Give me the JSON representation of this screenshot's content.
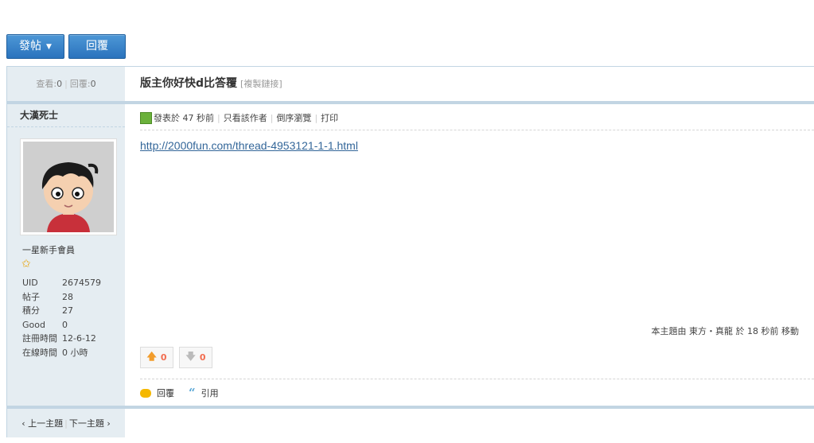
{
  "toolbar": {
    "post_label": "發帖",
    "reply_label": "回覆",
    "caret": "▼"
  },
  "stats": {
    "views_label": "查看:",
    "views": "0",
    "replies_label": "回覆:",
    "replies": "0"
  },
  "thread": {
    "title": "版主你好快d比答覆",
    "copy_link": "[複製鏈接]"
  },
  "author": {
    "name": "大漢死士",
    "rank": "一星新手會員",
    "info": [
      {
        "k": "UID",
        "v": "2674579"
      },
      {
        "k": "帖子",
        "v": "28"
      },
      {
        "k": "積分",
        "v": "27"
      },
      {
        "k": "Good",
        "v": "0"
      },
      {
        "k": "註冊時間",
        "v": "12-6-12"
      },
      {
        "k": "在線時間",
        "v": "0 小時"
      }
    ]
  },
  "meta": {
    "posted": "發表於 47 秒前",
    "only_author": "只看該作者",
    "reverse": "倒序瀏覽",
    "print": "打印"
  },
  "post": {
    "link": "http://2000fun.com/thread-4953121-1-1.html"
  },
  "moved_note": "本主題由 東方・真龍 於 18 秒前 移動",
  "votes": {
    "up": "0",
    "down": "0"
  },
  "actions": {
    "reply": "回覆",
    "quote": "引用",
    "quote_glyph": "“"
  },
  "nav": {
    "prev": "‹ 上一主題",
    "next": "下一主題 ›"
  },
  "colors": {
    "button": "#2a73bd",
    "border": "#c2d5e3",
    "sidebar": "#e5edf2",
    "link": "#336699"
  }
}
